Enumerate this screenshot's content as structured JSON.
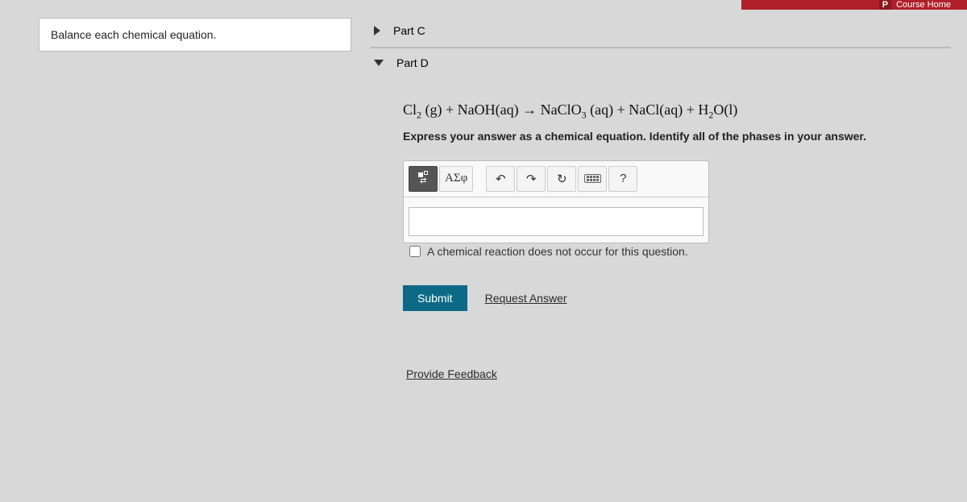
{
  "header": {
    "badge": "P",
    "link": "Course Home"
  },
  "left": {
    "prompt": "Balance each chemical equation."
  },
  "parts": {
    "c": {
      "label": "Part C"
    },
    "d": {
      "label": "Part D",
      "equation_html": "Cl<sub>2</sub> (g) + NaOH(aq) → NaClO<sub>3</sub> (aq) + NaCl(aq) + H<sub>2</sub>O(l)",
      "instruction": "Express your answer as a chemical equation. Identify all of the phases in your answer.",
      "toolbar": {
        "template": "template-icon",
        "greek": "ΑΣφ",
        "undo": "↶",
        "redo": "↷",
        "reset": "↻",
        "keyboard": "keyboard-icon",
        "help": "?"
      },
      "input_value": "",
      "no_reaction_label": "A chemical reaction does not occur for this question.",
      "submit": "Submit",
      "request": "Request Answer"
    }
  },
  "feedback": "Provide Feedback"
}
